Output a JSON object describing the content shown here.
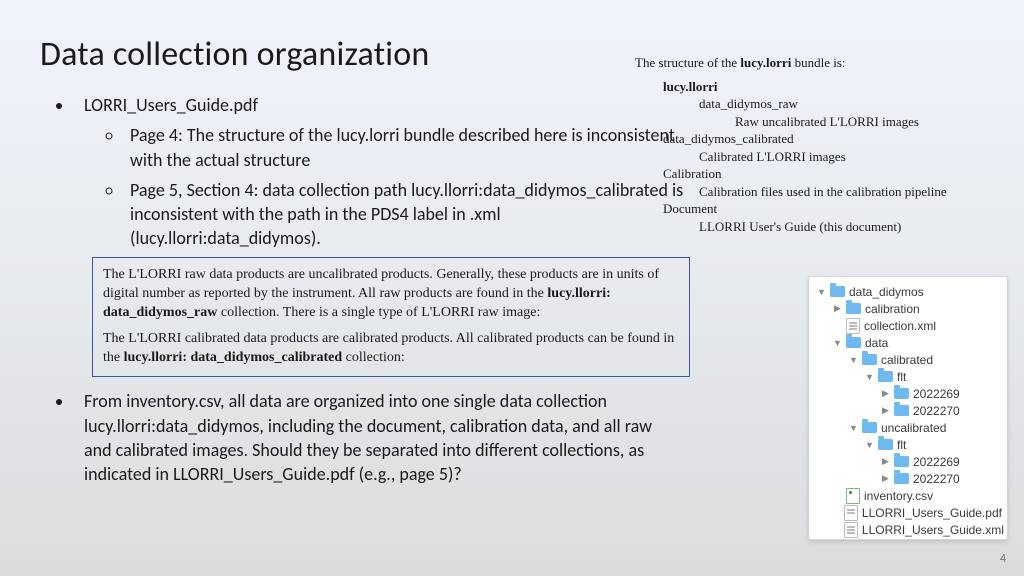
{
  "title": "Data collection organization",
  "page_number": "4",
  "bullets": {
    "b1": "LORRI_Users_Guide.pdf",
    "b1a": "Page 4: The structure of the lucy.lorri bundle described here is inconsistent with the actual structure",
    "b1b": "Page 5, Section 4: data collection path lucy.llorri:data_didymos_calibrated is inconsistent with the path in the PDS4 label in .xml (lucy.llorri:data_didymos).",
    "b2": "From inventory.csv, all data are organized into one single data collection lucy.llorri:data_didymos, including the document, calibration data, and all raw and calibrated images.  Should they be separated into different collections, as indicated in LLORRI_Users_Guide.pdf (e.g., page 5)?"
  },
  "bundle": {
    "intro_pre": "The structure of the ",
    "intro_bold": "lucy.lorri",
    "intro_post": " bundle is:",
    "root": "lucy.llorri",
    "r1": "data_didymos_raw",
    "r1d": "Raw uncalibrated L'LORRI images",
    "r2": "data_didymos_calibrated",
    "r2d": "Calibrated L'LORRI images",
    "r3": "Calibration",
    "r3d": "Calibration files used in the calibration pipeline",
    "r4": "Document",
    "r4d": "LLORRI User's Guide (this document)"
  },
  "excerpt": {
    "p1_pre": "The L'LORRI raw data products are uncalibrated products. Generally, these products are in units of digital number as reported by the instrument. All raw products are found in the ",
    "p1_bold": "lucy.llorri: data_didymos_raw",
    "p1_post": " collection. There is a single type of L'LORRI raw image:",
    "p2_pre": "The L'LORRI calibrated data products are calibrated products. All calibrated products can be found in the ",
    "p2_bold": "lucy.llorri: data_didymos_calibrated",
    "p2_post": " collection:"
  },
  "tree": {
    "n0": "data_didymos",
    "n1": "calibration",
    "n2": "collection.xml",
    "n3": "data",
    "n4": "calibrated",
    "n5": "flt",
    "n6": "2022269",
    "n7": "2022270",
    "n8": "uncalibrated",
    "n9": "flt",
    "n10": "2022269",
    "n11": "2022270",
    "n12": "inventory.csv",
    "n13": "LLORRI_Users_Guide.pdf",
    "n14": "LLORRI_Users_Guide.xml"
  }
}
